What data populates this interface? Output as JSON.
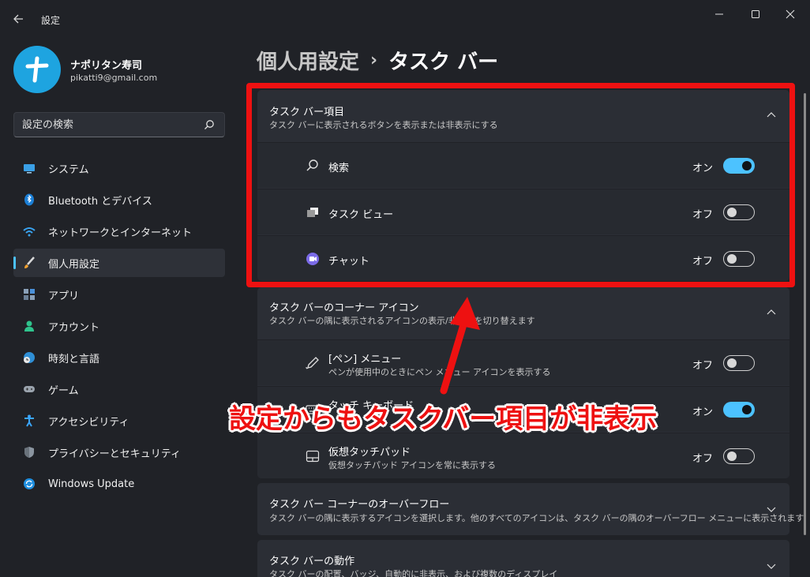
{
  "window": {
    "title": "設定"
  },
  "user": {
    "name": "ナポリタン寿司",
    "email": "pikatti9@gmail.com"
  },
  "search": {
    "placeholder": "設定の検索"
  },
  "nav": [
    {
      "label": "システム",
      "icon": "monitor-icon",
      "active": false
    },
    {
      "label": "Bluetooth とデバイス",
      "icon": "bluetooth-icon",
      "active": false
    },
    {
      "label": "ネットワークとインターネット",
      "icon": "wifi-icon",
      "active": false
    },
    {
      "label": "個人用設定",
      "icon": "brush-icon",
      "active": true
    },
    {
      "label": "アプリ",
      "icon": "apps-icon",
      "active": false
    },
    {
      "label": "アカウント",
      "icon": "person-icon",
      "active": false
    },
    {
      "label": "時刻と言語",
      "icon": "globe-clock-icon",
      "active": false
    },
    {
      "label": "ゲーム",
      "icon": "gamepad-icon",
      "active": false
    },
    {
      "label": "アクセシビリティ",
      "icon": "accessibility-icon",
      "active": false
    },
    {
      "label": "プライバシーとセキュリティ",
      "icon": "shield-icon",
      "active": false
    },
    {
      "label": "Windows Update",
      "icon": "update-icon",
      "active": false
    }
  ],
  "breadcrumb": {
    "parent": "個人用設定",
    "separator": "›",
    "current": "タスク バー"
  },
  "sections": [
    {
      "title": "タスク バー項目",
      "subtitle": "タスク バーに表示されるボタンを表示または非表示にする",
      "expanded": true,
      "rows": [
        {
          "title": "検索",
          "subtitle": "",
          "icon": "search-icon",
          "state": "オン",
          "on": true
        },
        {
          "title": "タスク ビュー",
          "subtitle": "",
          "icon": "task-view-icon",
          "state": "オフ",
          "on": false
        },
        {
          "title": "チャット",
          "subtitle": "",
          "icon": "chat-icon",
          "state": "オフ",
          "on": false
        }
      ]
    },
    {
      "title": "タスク バーのコーナー アイコン",
      "subtitle": "タスク バーの隅に表示されるアイコンの表示/非表示を切り替えます",
      "expanded": true,
      "rows": [
        {
          "title": "[ペン] メニュー",
          "subtitle": "ペンが使用中のときにペン メニュー アイコンを表示する",
          "icon": "pen-icon",
          "state": "オフ",
          "on": false
        },
        {
          "title": "タッチ キーボード",
          "subtitle": "",
          "icon": "keyboard-icon",
          "state": "オン",
          "on": true
        },
        {
          "title": "仮想タッチパッド",
          "subtitle": "仮想タッチパッド アイコンを常に表示する",
          "icon": "touchpad-icon",
          "state": "オフ",
          "on": false
        }
      ]
    },
    {
      "title": "タスク バー コーナーのオーバーフロー",
      "subtitle": "タスク バーの隅に表示するアイコンを選択します。他のすべてのアイコンは、タスク バーの隅のオーバーフロー メニューに表示されます",
      "expanded": false
    },
    {
      "title": "タスク バーの動作",
      "subtitle": "タスク バーの配置、バッジ、自動的に非表示、および複数のディスプレイ",
      "expanded": false
    }
  ],
  "annotation": {
    "text": "設定からもタスクバー項目が非表示",
    "color": "#ee1111"
  },
  "colors": {
    "accent": "#4cc2ff",
    "background": "#202227",
    "card": "#2b2e35"
  }
}
